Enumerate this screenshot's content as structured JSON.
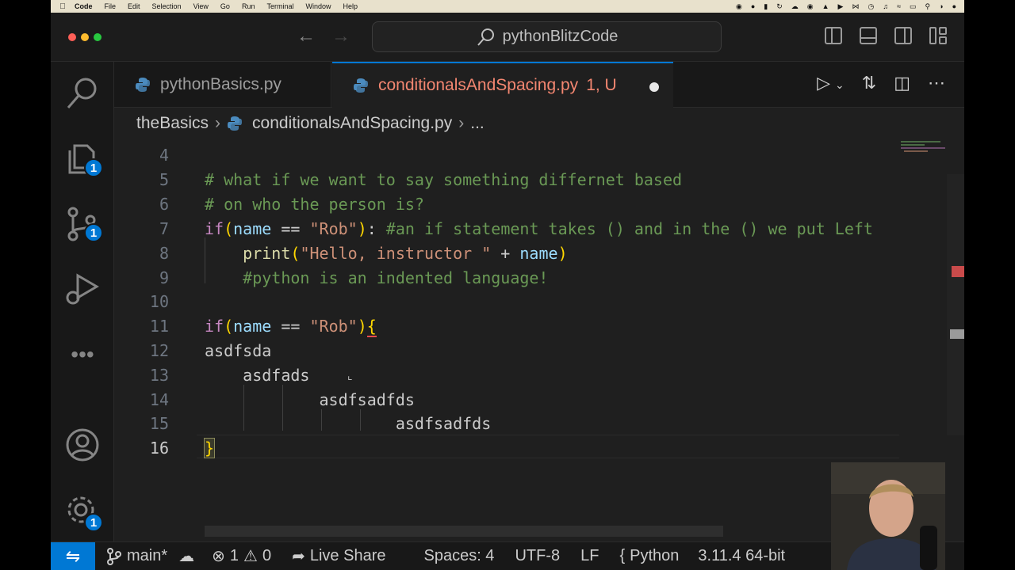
{
  "menubar": {
    "app": "Code",
    "items": [
      "File",
      "Edit",
      "Selection",
      "View",
      "Go",
      "Run",
      "Terminal",
      "Window",
      "Help"
    ]
  },
  "titlebar": {
    "search_text": "pythonBlitzCode"
  },
  "activity": {
    "explorer_badge": "1",
    "scm_badge": "1",
    "settings_badge": "1"
  },
  "tabs": [
    {
      "label": "pythonBasics.py"
    },
    {
      "label": "conditionalsAndSpacing.py",
      "status": "1, U"
    }
  ],
  "breadcrumb": {
    "folder": "theBasics",
    "file": "conditionalsAndSpacing.py",
    "more": "..."
  },
  "editor": {
    "line_numbers": [
      "4",
      "5",
      "6",
      "7",
      "8",
      "9",
      "10",
      "11",
      "12",
      "13",
      "14",
      "15",
      "16"
    ],
    "lines": {
      "l5": "# what if we want to say something differnet based",
      "l6": "# on who the person is?",
      "l7_kw": "if",
      "l7_open": "(",
      "l7_var": "name",
      "l7_op": " == ",
      "l7_str": "\"Rob\"",
      "l7_close": ")",
      "l7_colon": ": ",
      "l7_comment": "#an if statement takes () and in the () we put Left",
      "l8_indent": "    ",
      "l8_fn": "print",
      "l8_open": "(",
      "l8_str": "\"Hello, instructor \"",
      "l8_op": " + ",
      "l8_var": "name",
      "l8_close": ")",
      "l9": "    #python is an indented language!",
      "l11_kw": "if",
      "l11_open": "(",
      "l11_var": "name",
      "l11_op": " == ",
      "l11_str": "\"Rob\"",
      "l11_close": ")",
      "l11_brace": "{",
      "l12": "asdfsda",
      "l13": "    asdfads",
      "l14": "            asdfsadfds",
      "l15": "                    asdfsadfds",
      "l16": "}"
    }
  },
  "statusbar": {
    "branch": "main*",
    "errors": "1",
    "warnings": "0",
    "live_share": "Live Share",
    "spaces": "Spaces: 4",
    "encoding": "UTF-8",
    "eol": "LF",
    "language": "Python",
    "interpreter": "3.11.4 64-bit"
  },
  "colors": {
    "accent": "#0078d4",
    "tab_modified": "#f48771",
    "comment": "#6a9955",
    "keyword": "#c586c0",
    "string": "#ce9178"
  }
}
